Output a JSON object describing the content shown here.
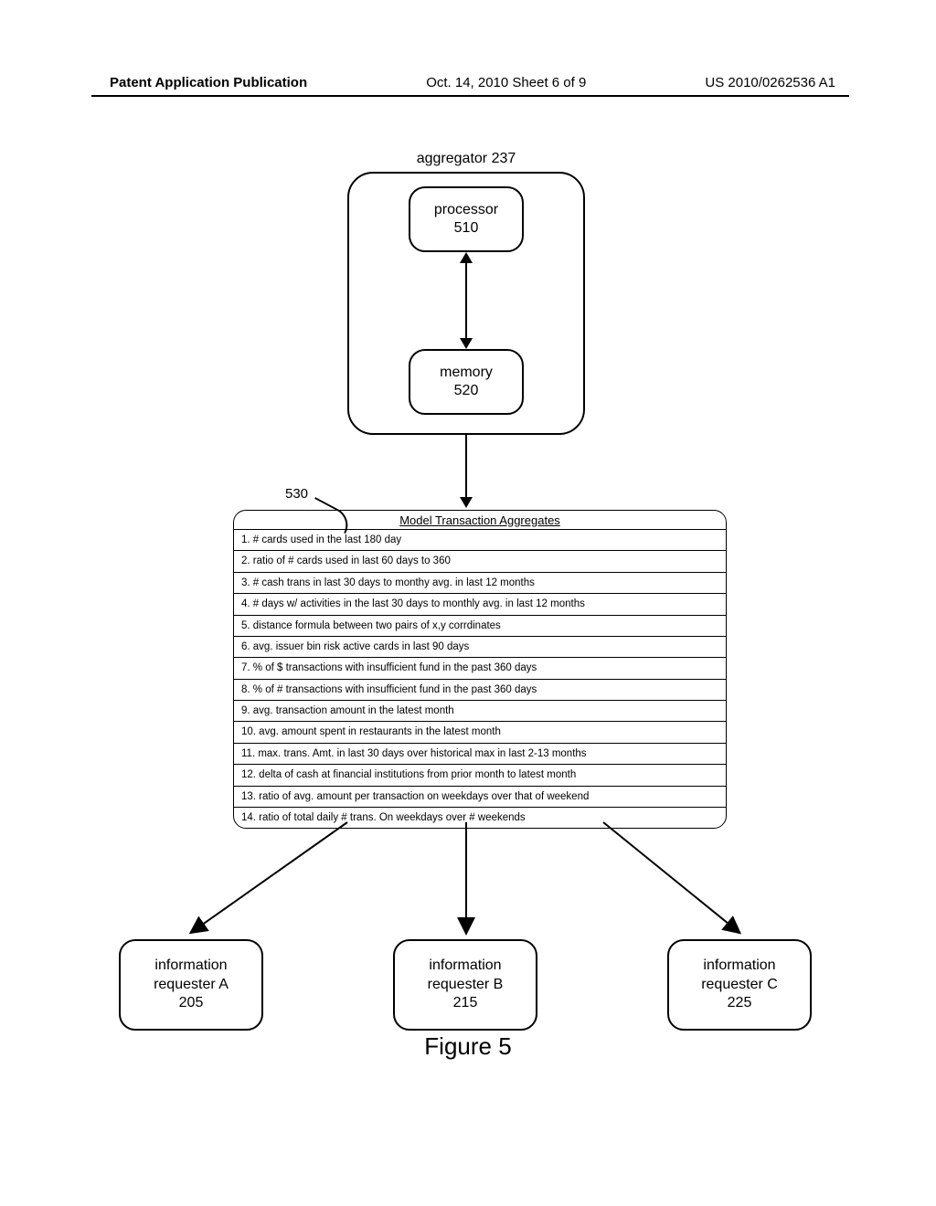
{
  "header": {
    "left": "Patent Application Publication",
    "center": "Oct. 14, 2010  Sheet 6 of 9",
    "right": "US 2010/0262536 A1"
  },
  "aggregator": {
    "label": "aggregator 237",
    "processor": {
      "line1": "processor",
      "line2": "510"
    },
    "memory": {
      "line1": "memory",
      "line2": "520"
    }
  },
  "ref530": "530",
  "table": {
    "title": "Model Transaction Aggregates",
    "rows": [
      "1. # cards used in the last 180 day",
      "2. ratio of # cards used in last 60 days to 360",
      "3. # cash trans in last 30 days to monthy avg. in last 12 months",
      "4. # days w/ activities in the last 30 days to monthly avg. in last 12 months",
      "5. distance formula between two pairs of x,y corrdinates",
      "6. avg. issuer bin risk  active cards in last 90 days",
      "7. % of $ transactions with insufficient fund in the past 360 days",
      "8. % of # transactions with insufficient fund in the past 360 days",
      "9. avg. transaction amount in the latest month",
      "10. avg. amount spent in restaurants in the latest month",
      "11. max. trans. Amt. in last 30 days over historical max in last 2-13 months",
      "12. delta of cash at financial institutions from prior month to latest month",
      "13. ratio of avg. amount per transaction on weekdays over that of weekend",
      "14. ratio of total daily # trans. On weekdays over # weekends"
    ]
  },
  "requesters": {
    "a": {
      "l1": "information",
      "l2": "requester A",
      "l3": "205"
    },
    "b": {
      "l1": "information",
      "l2": "requester B",
      "l3": "215"
    },
    "c": {
      "l1": "information",
      "l2": "requester C",
      "l3": "225"
    }
  },
  "figure_caption": "Figure 5"
}
